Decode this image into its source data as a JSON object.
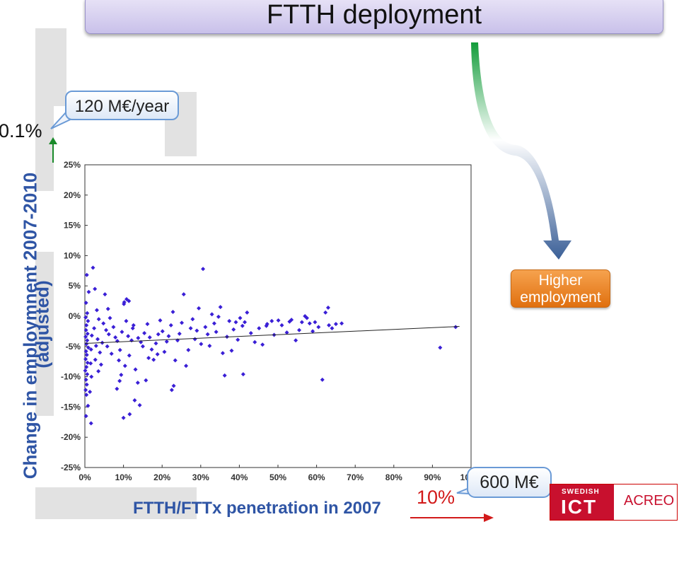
{
  "title": "FTTH deployment",
  "y_axis_label": "Change in employmnent 2007-2010",
  "y_axis_sublabel": "(adjusted)",
  "x_axis_label": "FTTH/FTTx penetration in 2007",
  "callout_top": "120 M€/year",
  "callout_bottom": "600 M€",
  "y_change_value": "0.1%",
  "x_change_value": "10%",
  "higher_employment_label": "Higher\nemployment",
  "logo": {
    "top": "SWEDISH",
    "ict": "ICT",
    "partner": "ACREO"
  },
  "colors": {
    "marker": "#3a1fd6",
    "axis_text": "#2f55a5",
    "arrow_green": "#1a8a2a",
    "arrow_red": "#d21a1a",
    "accent_orange": "#e87f20"
  },
  "chart_data": {
    "type": "scatter",
    "xlim": [
      0,
      100
    ],
    "ylim": [
      -25,
      25
    ],
    "x_ticks": [
      "0%",
      "10%",
      "20%",
      "30%",
      "40%",
      "50%",
      "60%",
      "70%",
      "80%",
      "90%",
      "100%"
    ],
    "y_ticks": [
      "25%",
      "20%",
      "15%",
      "10%",
      "5%",
      "0%",
      "-5%",
      "-10%",
      "-15%",
      "-20%",
      "-25%"
    ],
    "trend_line": {
      "x": [
        0,
        97
      ],
      "y": [
        -4.5,
        -1.7
      ]
    },
    "points": [
      [
        0.5,
        6.8
      ],
      [
        1.0,
        4.0
      ],
      [
        0.3,
        2.2
      ],
      [
        0.6,
        0.5
      ],
      [
        0.2,
        -0.2
      ],
      [
        0.8,
        -0.8
      ],
      [
        0.4,
        -1.5
      ],
      [
        0.3,
        -2.3
      ],
      [
        0.7,
        -2.9
      ],
      [
        0.2,
        -3.4
      ],
      [
        0.6,
        -4.0
      ],
      [
        0.4,
        -4.6
      ],
      [
        0.9,
        -5.2
      ],
      [
        0.3,
        -5.8
      ],
      [
        0.5,
        -6.4
      ],
      [
        0.2,
        -7.1
      ],
      [
        0.7,
        -7.7
      ],
      [
        0.4,
        -8.4
      ],
      [
        0.1,
        -9.0
      ],
      [
        0.6,
        -9.6
      ],
      [
        0.3,
        -10.5
      ],
      [
        0.5,
        -11.3
      ],
      [
        0.2,
        -12.2
      ],
      [
        0.4,
        -13.0
      ],
      [
        0.8,
        -14.8
      ],
      [
        0.3,
        -16.5
      ],
      [
        1.6,
        -17.7
      ],
      [
        1.8,
        -3.2
      ],
      [
        1.6,
        -5.5
      ],
      [
        1.5,
        -7.8
      ],
      [
        1.7,
        -10.0
      ],
      [
        1.3,
        -12.5
      ],
      [
        2.1,
        8.0
      ],
      [
        2.6,
        4.5
      ],
      [
        3.1,
        1.0
      ],
      [
        3.6,
        -0.5
      ],
      [
        2.4,
        -2.0
      ],
      [
        3.3,
        -3.8
      ],
      [
        2.9,
        -4.9
      ],
      [
        3.9,
        -6.0
      ],
      [
        2.7,
        -7.2
      ],
      [
        4.2,
        -8.0
      ],
      [
        3.5,
        -9.1
      ],
      [
        4.8,
        -1.2
      ],
      [
        5.5,
        -2.3
      ],
      [
        6.2,
        -3.0
      ],
      [
        4.5,
        -4.4
      ],
      [
        5.8,
        -5.0
      ],
      [
        6.5,
        -0.3
      ],
      [
        5.2,
        3.6
      ],
      [
        6.9,
        -6.2
      ],
      [
        7.4,
        -1.8
      ],
      [
        7.9,
        -3.5
      ],
      [
        8.4,
        -4.1
      ],
      [
        6.0,
        1.2
      ],
      [
        9.1,
        -5.6
      ],
      [
        9.6,
        -2.6
      ],
      [
        10.1,
        2.0
      ],
      [
        10.7,
        -0.8
      ],
      [
        11.2,
        -3.3
      ],
      [
        8.8,
        -7.3
      ],
      [
        9.4,
        -9.7
      ],
      [
        10.4,
        -8.2
      ],
      [
        11.5,
        -6.5
      ],
      [
        12.1,
        -4.0
      ],
      [
        12.6,
        -1.5
      ],
      [
        13.1,
        -8.8
      ],
      [
        13.7,
        -11.0
      ],
      [
        9.0,
        -10.7
      ],
      [
        8.3,
        -12.0
      ],
      [
        10.0,
        -16.8
      ],
      [
        11.6,
        -16.2
      ],
      [
        12.9,
        -13.9
      ],
      [
        14.2,
        -14.7
      ],
      [
        10.2,
        2.3
      ],
      [
        10.8,
        2.8
      ],
      [
        11.4,
        2.5
      ],
      [
        12.4,
        -2.0
      ],
      [
        13.8,
        -3.6
      ],
      [
        15.0,
        -5.0
      ],
      [
        14.5,
        -4.3
      ],
      [
        15.4,
        -2.8
      ],
      [
        16.2,
        -1.3
      ],
      [
        16.8,
        -3.5
      ],
      [
        17.3,
        -5.5
      ],
      [
        17.8,
        -7.2
      ],
      [
        18.4,
        -4.5
      ],
      [
        19.0,
        -3.0
      ],
      [
        15.8,
        -10.6
      ],
      [
        16.5,
        -6.9
      ],
      [
        18.8,
        -6.3
      ],
      [
        19.5,
        -0.7
      ],
      [
        20.1,
        -2.5
      ],
      [
        20.6,
        -5.9
      ],
      [
        21.2,
        -4.2
      ],
      [
        21.7,
        -3.3
      ],
      [
        22.3,
        -1.5
      ],
      [
        22.8,
        0.7
      ],
      [
        23.4,
        -7.3
      ],
      [
        24.0,
        -4.0
      ],
      [
        24.5,
        -2.9
      ],
      [
        25.1,
        -1.1
      ],
      [
        25.6,
        3.6
      ],
      [
        23.0,
        -11.5
      ],
      [
        22.5,
        -12.2
      ],
      [
        26.2,
        -8.2
      ],
      [
        26.8,
        -5.6
      ],
      [
        27.4,
        -2.0
      ],
      [
        27.9,
        -0.5
      ],
      [
        28.5,
        -3.8
      ],
      [
        29.0,
        -2.4
      ],
      [
        30.1,
        -4.6
      ],
      [
        30.6,
        7.8
      ],
      [
        29.5,
        1.3
      ],
      [
        31.2,
        -1.8
      ],
      [
        31.8,
        -3.0
      ],
      [
        32.3,
        -4.9
      ],
      [
        32.9,
        0.3
      ],
      [
        33.5,
        -1.2
      ],
      [
        34.0,
        -2.6
      ],
      [
        34.6,
        -0.1
      ],
      [
        35.1,
        1.5
      ],
      [
        35.7,
        -6.1
      ],
      [
        36.2,
        -9.8
      ],
      [
        36.8,
        -3.4
      ],
      [
        37.4,
        -0.8
      ],
      [
        38.0,
        -5.7
      ],
      [
        38.5,
        -2.2
      ],
      [
        39.1,
        -1.0
      ],
      [
        39.6,
        -3.9
      ],
      [
        40.2,
        -0.3
      ],
      [
        40.8,
        -1.6
      ],
      [
        41.4,
        -1.0
      ],
      [
        42.0,
        0.6
      ],
      [
        41.0,
        -9.6
      ],
      [
        43.0,
        -2.8
      ],
      [
        44.0,
        -4.3
      ],
      [
        45.1,
        -2.0
      ],
      [
        46.0,
        -4.7
      ],
      [
        47.2,
        -1.3
      ],
      [
        48.4,
        -0.8
      ],
      [
        49.0,
        -3.1
      ],
      [
        50.1,
        -0.7
      ],
      [
        51.0,
        -1.5
      ],
      [
        52.3,
        -2.7
      ],
      [
        53.0,
        -0.9
      ],
      [
        54.6,
        -4.0
      ],
      [
        55.5,
        -2.3
      ],
      [
        56.2,
        -1.0
      ],
      [
        57.0,
        0.0
      ],
      [
        58.2,
        -1.2
      ],
      [
        59.0,
        -2.5
      ],
      [
        59.6,
        -1.0
      ],
      [
        60.5,
        -1.8
      ],
      [
        61.5,
        -10.5
      ],
      [
        62.3,
        0.6
      ],
      [
        63.2,
        -1.5
      ],
      [
        64.0,
        -2.0
      ],
      [
        65.0,
        -1.3
      ],
      [
        66.5,
        -1.2
      ],
      [
        92.0,
        -5.2
      ],
      [
        96.0,
        -1.8
      ],
      [
        47.0,
        -1.6
      ],
      [
        53.5,
        -0.6
      ],
      [
        57.5,
        -0.3
      ],
      [
        63.0,
        1.4
      ]
    ]
  }
}
